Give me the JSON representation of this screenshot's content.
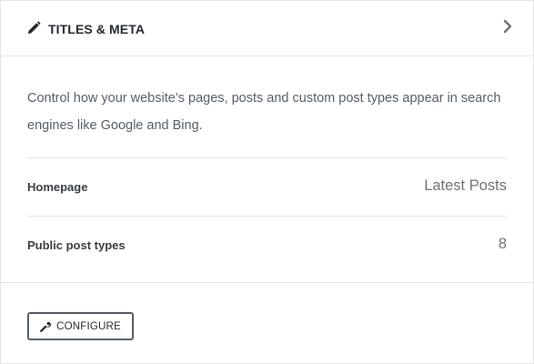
{
  "card": {
    "header": {
      "title": "TITLES & META",
      "icon": "pencil-icon",
      "toggle_icon": "chevron-right-icon"
    },
    "description": "Control how your website’s pages, posts and custom post types appear in search engines like Google and Bing.",
    "rows": [
      {
        "label": "Homepage",
        "value": "Latest Posts"
      },
      {
        "label": "Public post types",
        "value": "8"
      }
    ],
    "footer": {
      "configure_label": "CONFIGURE",
      "configure_icon": "wrench-icon"
    }
  },
  "colors": {
    "title": "#23282d",
    "body_text": "#555d66",
    "value_text": "#6b7178",
    "border": "#e5e5e5",
    "button_border": "#555d66"
  }
}
